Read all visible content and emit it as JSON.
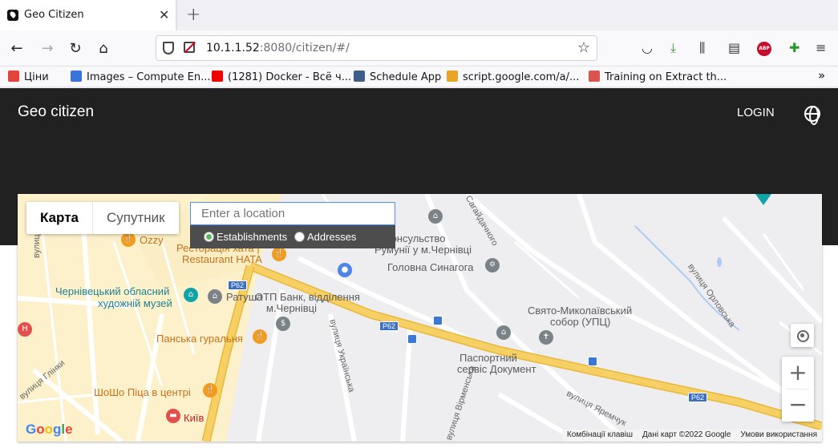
{
  "browser": {
    "tab": {
      "title": "Geo Citizen"
    },
    "url": {
      "host": "10.1.1.52",
      "path": ":8080/citizen/#/"
    },
    "bookmarks": [
      "Ціни",
      "Images – Compute En...",
      "(1281) Docker - Всё ч...",
      "Schedule App",
      "script.google.com/a/...",
      "Training on Extract th..."
    ]
  },
  "app": {
    "brand": "Geo citizen",
    "login_label": "LOGIN"
  },
  "map": {
    "map_type": {
      "map": "Карта",
      "satellite": "Супутник"
    },
    "search": {
      "placeholder": "Enter a location",
      "filter_establishments": "Establishments",
      "filter_addresses": "Addresses",
      "selected": "Establishments"
    },
    "labels": {
      "ozzy": "Ozzy",
      "restaurant_1": "Ресторація хата |",
      "restaurant_2": "Restaurant HATA",
      "consulate_1": "Консульство",
      "consulate_2": "Румунії у м.Чернівці",
      "synagogue": "Головна Синагога",
      "museum_1": "Чернівецький обласний",
      "museum_2": "художній музей",
      "ratusha": "Ратуша",
      "bank_1": "ОТП Банк, відділення",
      "bank_2": "м.Чернівці",
      "cathedral_1": "Свято-Миколаївський",
      "cathedral_2": "собор (УПЦ)",
      "gural": "Панська гуральня",
      "passport_1": "Паспортний",
      "passport_2": "сервіс Документ",
      "pizza": "ШоШо Піца в центрі",
      "kyiv": "Київ",
      "street_gete": "вулиця Гете",
      "street_glinki": "вулиця Глінки",
      "street_ukrainska": "вулиця Українська",
      "street_virmenska": "вулиця Вірменська",
      "street_sagaidachnogo": "Сагайдачного",
      "street_orlovska": "вулиця Орловська",
      "street_yaremchuka": "вулиця Яремчук",
      "road_p62": "P62"
    },
    "attribution": {
      "google": "Google",
      "shortcuts": "Комбінації клавіш",
      "data": "Дані карт ©2022 Google",
      "terms": "Умови використання"
    }
  },
  "colors": {
    "app_bar": "#212121",
    "main_road": "#f6cf65",
    "urban_area": "#fdf1cb"
  }
}
